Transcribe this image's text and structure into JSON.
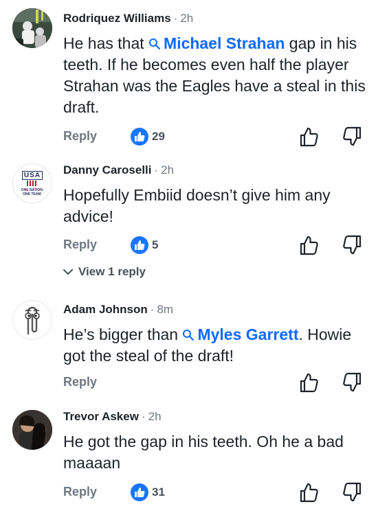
{
  "comments": [
    {
      "author": "Rodriquez Williams",
      "time": "2h",
      "text_before": "He has that ",
      "mention": "Michael Strahan",
      "text_after": " gap in his teeth. If he becomes even half the player Strahan was the Eagles have a steal in this draft.",
      "reply_label": "Reply",
      "likes": "29",
      "avatar_icon": "football-photo-avatar"
    },
    {
      "author": "Danny Caroselli",
      "time": "2h",
      "text": "Hopefully Embiid doesn’t give him any advice!",
      "reply_label": "Reply",
      "likes": "5",
      "view_replies": "View 1 reply",
      "avatar_logo": {
        "letters": "USA",
        "tagline_1": "ONE NATION.",
        "tagline_2": "ONE TEAM."
      }
    },
    {
      "author": "Adam Johnson",
      "time": "8m",
      "text_before": "He’s bigger than ",
      "mention": "Myles Garrett",
      "text_after": ". Howie got the steal of the draft!",
      "reply_label": "Reply",
      "avatar_icon": "paperclip-avatar"
    },
    {
      "author": "Trevor Askew",
      "time": "2h",
      "text": "He got the gap in his teeth. Oh he a bad maaaan",
      "reply_label": "Reply",
      "likes": "31",
      "avatar_icon": "photo-avatar"
    }
  ],
  "colors": {
    "link": "#0f69ff",
    "like_badge": "#1a75ff",
    "muted": "#6e7780"
  }
}
